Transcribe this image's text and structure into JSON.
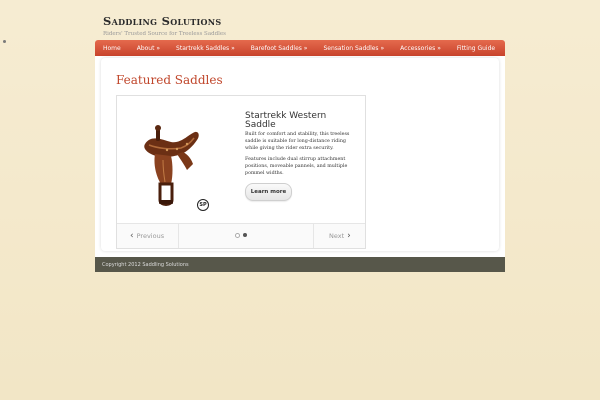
{
  "site": {
    "title": "Saddling Solutions",
    "tagline": "Riders' Trusted Source for Treeless Saddles"
  },
  "nav": {
    "items": [
      {
        "label": "Home"
      },
      {
        "label": "About »"
      },
      {
        "label": "Startrekk Saddles »"
      },
      {
        "label": "Barefoot Saddles »"
      },
      {
        "label": "Sensation Saddles »"
      },
      {
        "label": "Accessories »"
      },
      {
        "label": "Fitting Guide"
      }
    ]
  },
  "main": {
    "title": "Featured Saddles",
    "slide": {
      "title": "Startrekk Western Saddle",
      "description_1": "Built for comfort and stability, this treeless saddle is suitable for long-distance riding while giving the rider extra security.",
      "description_2": "Features include dual stirrup attachment positions, moveable pannels, and multiple pommel widths.",
      "button_label": "Learn more",
      "image_icon": "saddle-photo",
      "badge_text": "SP"
    },
    "slider_nav": {
      "previous_label": "Previous",
      "next_label": "Next",
      "pages": 2,
      "active_page": 2
    }
  },
  "footer": {
    "text": "Copyright 2012 Saddling Solutions"
  },
  "colors": {
    "nav_top": "#e56a4d",
    "nav_bottom": "#c8432c",
    "title_red": "#c0462b",
    "footer_bg": "#57574a",
    "page_bg": "#f3e8c9"
  }
}
